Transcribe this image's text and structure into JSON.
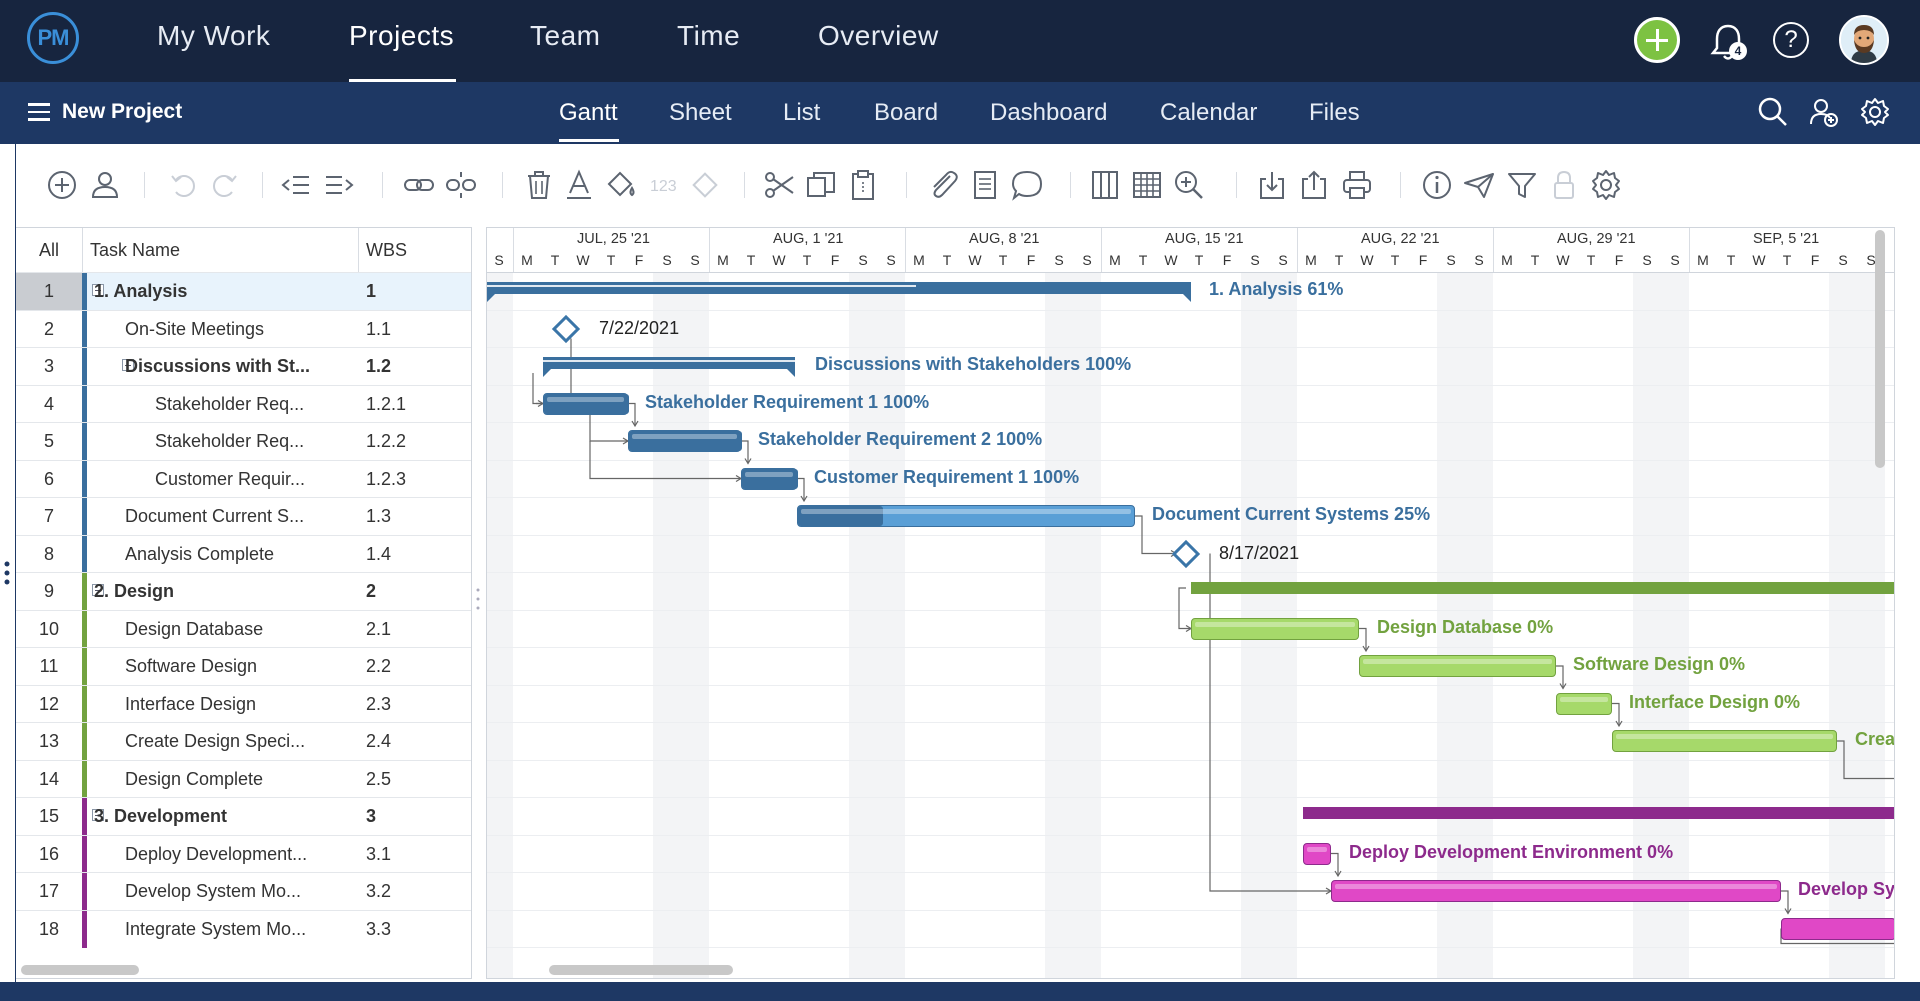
{
  "app": {
    "logo_text": "PM"
  },
  "top_nav": {
    "tabs": [
      "My Work",
      "Projects",
      "Team",
      "Time",
      "Overview"
    ],
    "active": "Projects",
    "notification_count": "4",
    "help_label": "?"
  },
  "sub_nav": {
    "project_name": "New Project",
    "views": [
      "Gantt",
      "Sheet",
      "List",
      "Board",
      "Dashboard",
      "Calendar",
      "Files"
    ],
    "active": "Gantt"
  },
  "toolbar": {
    "icons": [
      "add-task-icon",
      "assign-user-icon",
      "undo-icon",
      "redo-icon",
      "outdent-icon",
      "indent-icon",
      "link-icon",
      "unlink-icon",
      "delete-icon",
      "font-color-icon",
      "fill-color-icon",
      "number-format-icon",
      "milestone-icon",
      "cut-icon",
      "copy-icon",
      "paste-icon",
      "attachment-icon",
      "notes-icon",
      "comment-icon",
      "columns-icon",
      "grid-icon",
      "zoom-icon",
      "import-icon",
      "export-icon",
      "print-icon",
      "info-icon",
      "send-icon",
      "filter-icon",
      "lock-icon",
      "settings-icon"
    ],
    "number_format_label": "123"
  },
  "grid": {
    "columns": {
      "all": "All",
      "task_name": "Task Name",
      "wbs": "WBS"
    },
    "rows": [
      {
        "num": "1",
        "name": "1. Analysis",
        "wbs": "1",
        "level": 0,
        "bold": true,
        "group": "analysis",
        "collapsible": true
      },
      {
        "num": "2",
        "name": "On-Site Meetings",
        "wbs": "1.1",
        "level": 1,
        "bold": false,
        "group": "analysis"
      },
      {
        "num": "3",
        "name": "Discussions with St...",
        "wbs": "1.2",
        "level": 1,
        "bold": true,
        "group": "analysis",
        "collapsible": true
      },
      {
        "num": "4",
        "name": "Stakeholder Req...",
        "wbs": "1.2.1",
        "level": 2,
        "bold": false,
        "group": "analysis"
      },
      {
        "num": "5",
        "name": "Stakeholder Req...",
        "wbs": "1.2.2",
        "level": 2,
        "bold": false,
        "group": "analysis"
      },
      {
        "num": "6",
        "name": "Customer Requir...",
        "wbs": "1.2.3",
        "level": 2,
        "bold": false,
        "group": "analysis"
      },
      {
        "num": "7",
        "name": "Document Current S...",
        "wbs": "1.3",
        "level": 1,
        "bold": false,
        "group": "analysis"
      },
      {
        "num": "8",
        "name": "Analysis Complete",
        "wbs": "1.4",
        "level": 1,
        "bold": false,
        "group": "analysis"
      },
      {
        "num": "9",
        "name": "2. Design",
        "wbs": "2",
        "level": 0,
        "bold": true,
        "group": "design",
        "collapsible": true
      },
      {
        "num": "10",
        "name": "Design Database",
        "wbs": "2.1",
        "level": 1,
        "bold": false,
        "group": "design"
      },
      {
        "num": "11",
        "name": "Software Design",
        "wbs": "2.2",
        "level": 1,
        "bold": false,
        "group": "design"
      },
      {
        "num": "12",
        "name": "Interface Design",
        "wbs": "2.3",
        "level": 1,
        "bold": false,
        "group": "design"
      },
      {
        "num": "13",
        "name": "Create Design Speci...",
        "wbs": "2.4",
        "level": 1,
        "bold": false,
        "group": "design"
      },
      {
        "num": "14",
        "name": "Design Complete",
        "wbs": "2.5",
        "level": 1,
        "bold": false,
        "group": "design"
      },
      {
        "num": "15",
        "name": "3. Development",
        "wbs": "3",
        "level": 0,
        "bold": true,
        "group": "development",
        "collapsible": true
      },
      {
        "num": "16",
        "name": "Deploy Development...",
        "wbs": "3.1",
        "level": 1,
        "bold": false,
        "group": "development"
      },
      {
        "num": "17",
        "name": "Develop System Mo...",
        "wbs": "3.2",
        "level": 1,
        "bold": false,
        "group": "development"
      },
      {
        "num": "18",
        "name": "Integrate System Mo...",
        "wbs": "3.3",
        "level": 1,
        "bold": false,
        "group": "development"
      }
    ],
    "selected_row": "1"
  },
  "colors": {
    "analysis": "#3a6f9e",
    "analysis_light": "#5a9fd6",
    "design": "#72a23f",
    "design_light": "#a6d96a",
    "development": "#8d2a8c",
    "development_light": "#e048c6",
    "nav_bg": "#17253f",
    "subnav_bg": "#1e3864"
  },
  "timeline": {
    "weeks": [
      "JUL, 25 '21",
      "AUG, 1 '21",
      "AUG, 8 '21",
      "AUG, 15 '21",
      "AUG, 22 '21",
      "AUG, 29 '21",
      "SEP, 5 '21"
    ],
    "days": [
      "S",
      "M",
      "T",
      "W",
      "T",
      "F",
      "S",
      "S",
      "M",
      "T",
      "W",
      "T",
      "F",
      "S",
      "S",
      "M",
      "T",
      "W",
      "T",
      "F",
      "S",
      "S",
      "M",
      "T",
      "W",
      "T",
      "F",
      "S",
      "S",
      "M",
      "T",
      "W",
      "T",
      "F",
      "S",
      "S",
      "M",
      "T",
      "W",
      "T",
      "F",
      "S",
      "S",
      "M",
      "T",
      "W",
      "T",
      "F",
      "S",
      "S"
    ]
  },
  "gantt": {
    "items": [
      {
        "row": 1,
        "kind": "summary",
        "label": "1. Analysis  61%",
        "group": "analysis",
        "progress": 0.61
      },
      {
        "row": 2,
        "kind": "milestone",
        "label": "7/22/2021"
      },
      {
        "row": 3,
        "kind": "summary",
        "label": "Discussions with Stakeholders  100%",
        "group": "analysis",
        "progress": 1.0
      },
      {
        "row": 4,
        "kind": "task",
        "label": "Stakeholder Requirement 1  100%",
        "group": "analysis",
        "progress": 1.0
      },
      {
        "row": 5,
        "kind": "task",
        "label": "Stakeholder Requirement 2  100%",
        "group": "analysis",
        "progress": 1.0
      },
      {
        "row": 6,
        "kind": "task",
        "label": "Customer Requirement 1  100%",
        "group": "analysis",
        "progress": 1.0
      },
      {
        "row": 7,
        "kind": "task",
        "label": "Document Current Systems  25%",
        "group": "analysis",
        "progress": 0.25
      },
      {
        "row": 8,
        "kind": "milestone",
        "label": "8/17/2021"
      },
      {
        "row": 10,
        "kind": "task",
        "label": "Design Database  0%",
        "group": "design",
        "progress": 0
      },
      {
        "row": 11,
        "kind": "task",
        "label": "Software Design  0%",
        "group": "design",
        "progress": 0
      },
      {
        "row": 12,
        "kind": "task",
        "label": "Interface Design  0%",
        "group": "design",
        "progress": 0
      },
      {
        "row": 13,
        "kind": "task",
        "label": "Crea",
        "group": "design",
        "progress": 0
      },
      {
        "row": 16,
        "kind": "task",
        "label": "Deploy Development Environment  0%",
        "group": "development",
        "progress": 0
      },
      {
        "row": 17,
        "kind": "task",
        "label": "Develop Sys",
        "group": "development",
        "progress": 0
      }
    ]
  }
}
